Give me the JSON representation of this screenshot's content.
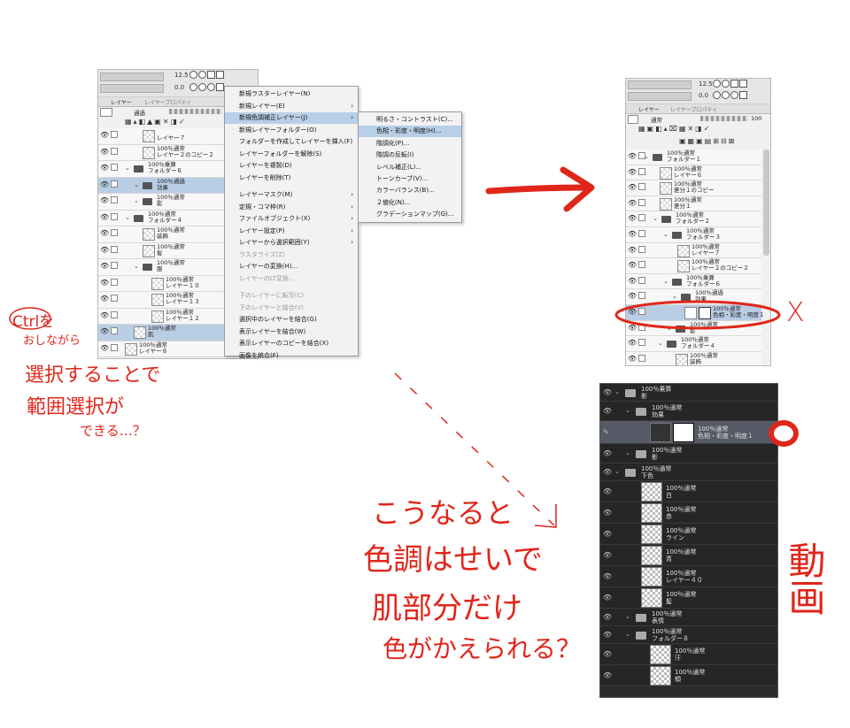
{
  "left_panel": {
    "zoom_value": "12.5",
    "rotate_value": "0.0",
    "tab_layer": "レイヤー",
    "tab_property": "レイヤープロパティ",
    "blend_mode": "通過",
    "layers": [
      {
        "title": "",
        "name": "レイヤー７",
        "kind": "layer"
      },
      {
        "title": "100％通常",
        "name": "レイヤー２のコピー２",
        "kind": "layer"
      },
      {
        "title": "100％乗算",
        "name": "フォルダー６",
        "kind": "folder"
      },
      {
        "title": "100％通過",
        "name": "効果",
        "kind": "folder",
        "selected": true
      },
      {
        "title": "100％通常",
        "name": "影",
        "kind": "folder"
      },
      {
        "title": "100％通常",
        "name": "フォルダー４",
        "kind": "folder"
      },
      {
        "title": "100％通常",
        "name": "装飾",
        "kind": "layer"
      },
      {
        "title": "100％通常",
        "name": "髪",
        "kind": "layer"
      },
      {
        "title": "100％通常",
        "name": "服",
        "kind": "folder"
      },
      {
        "title": "100％通常",
        "name": "レイヤー１０",
        "kind": "layer"
      },
      {
        "title": "100％通常",
        "name": "レイヤー１３",
        "kind": "layer"
      },
      {
        "title": "100％通常",
        "name": "レイヤー１２",
        "kind": "layer"
      },
      {
        "title": "100％通常",
        "name": "肌",
        "kind": "layer",
        "selected": true
      },
      {
        "title": "100％通常",
        "name": "レイヤー８",
        "kind": "layer"
      }
    ]
  },
  "context_menu": {
    "items": [
      {
        "label": "新規ラスターレイヤー(N)"
      },
      {
        "label": "新規レイヤー(E)",
        "submenu": true
      },
      {
        "label": "新規色調補正レイヤー(J)",
        "submenu": true,
        "highlight": true
      },
      {
        "label": "新規レイヤーフォルダー(O)"
      },
      {
        "label": "フォルダーを作成してレイヤーを挿入(F)"
      },
      {
        "label": "レイヤーフォルダーを解除(S)"
      },
      {
        "label": "レイヤーを複製(D)"
      },
      {
        "label": "レイヤーを削除(T)"
      },
      {
        "label": "レイヤーマスク(M)",
        "submenu": true
      },
      {
        "label": "定規・コマ枠(R)",
        "submenu": true
      },
      {
        "label": "ファイルオブジェクト(X)",
        "submenu": true
      },
      {
        "label": "レイヤー設定(P)",
        "submenu": true
      },
      {
        "label": "レイヤーから選択範囲(Y)",
        "submenu": true
      },
      {
        "label": "ラスタライズ(Z)",
        "disabled": true
      },
      {
        "label": "レイヤーの変換(H)..."
      },
      {
        "label": "レイヤーのLT変換...",
        "disabled": true
      },
      {
        "label": "下のレイヤーに転写(C)",
        "disabled": true
      },
      {
        "label": "下のレイヤーと結合(V)",
        "disabled": true
      },
      {
        "label": "選択中のレイヤーを結合(G)"
      },
      {
        "label": "表示レイヤーを結合(W)"
      },
      {
        "label": "表示レイヤーのコピーを結合(X)"
      },
      {
        "label": "画像を統合(F)"
      }
    ]
  },
  "submenu": {
    "items": [
      {
        "label": "明るさ・コントラスト(C)..."
      },
      {
        "label": "色相・彩度・明度(H)...",
        "highlight": true
      },
      {
        "label": "階調化(P)..."
      },
      {
        "label": "階調の反転(I)"
      },
      {
        "label": "レベル補正(L)..."
      },
      {
        "label": "トーンカーブ(V)..."
      },
      {
        "label": "カラーバランス(B)..."
      },
      {
        "label": "２値化(N)..."
      },
      {
        "label": "グラデーションマップ(G)..."
      }
    ]
  },
  "right_panel": {
    "zoom_value": "12.5",
    "rotate_value": "0.0",
    "tab_layer": "レイヤー",
    "tab_property": "レイヤープロパティ",
    "blend_mode": "通常",
    "opacity": "100",
    "layers": [
      {
        "title": "100％通常",
        "name": "フォルダー１",
        "kind": "folder"
      },
      {
        "title": "100％通常",
        "name": "レイヤー６",
        "kind": "layer"
      },
      {
        "title": "100％通常",
        "name": "差分１のコピー",
        "kind": "layer"
      },
      {
        "title": "100％通常",
        "name": "差分１",
        "kind": "layer"
      },
      {
        "title": "100％通常",
        "name": "フォルダー２",
        "kind": "folder"
      },
      {
        "title": "100％通常",
        "name": "フォルダー３",
        "kind": "folder"
      },
      {
        "title": "100％通常",
        "name": "レイヤー７",
        "kind": "layer"
      },
      {
        "title": "100％通常",
        "name": "レイヤー２のコピー２",
        "kind": "layer"
      },
      {
        "title": "100％乗算",
        "name": "フォルダー６",
        "kind": "folder"
      },
      {
        "title": "100％通過",
        "name": "効果",
        "kind": "folder"
      },
      {
        "title": "100％通常",
        "name": "色相・彩度・明度１",
        "kind": "adjust",
        "selected": true
      },
      {
        "title": "100％通常",
        "name": "影",
        "kind": "folder"
      },
      {
        "title": "100％通常",
        "name": "フォルダー４",
        "kind": "folder"
      },
      {
        "title": "100％通常",
        "name": "装飾",
        "kind": "layer"
      }
    ]
  },
  "dark_panel": {
    "layers": [
      {
        "title": "100％乗算",
        "name": "影",
        "kind": "folder"
      },
      {
        "title": "100％通常",
        "name": "効果",
        "kind": "folder"
      },
      {
        "title": "100％通常",
        "name": "色相・彩度・明度１",
        "kind": "adjust",
        "selected": true
      },
      {
        "title": "100％通常",
        "name": "影",
        "kind": "folder"
      },
      {
        "title": "100％通常",
        "name": "下色",
        "kind": "folder"
      },
      {
        "title": "100％通常",
        "name": "白",
        "kind": "layer"
      },
      {
        "title": "100％通常",
        "name": "赤",
        "kind": "layer"
      },
      {
        "title": "100％通常",
        "name": "ライン",
        "kind": "layer"
      },
      {
        "title": "100％通常",
        "name": "青",
        "kind": "layer"
      },
      {
        "title": "100％通常",
        "name": "レイヤー４０",
        "kind": "layer"
      },
      {
        "title": "100％通常",
        "name": "髪",
        "kind": "layer"
      },
      {
        "title": "100％通常",
        "name": "表情",
        "kind": "folder"
      },
      {
        "title": "100％通常",
        "name": "フォルダー８",
        "kind": "folder"
      },
      {
        "title": "100％通常",
        "name": "汗",
        "kind": "layer"
      },
      {
        "title": "100％通常",
        "name": "頬",
        "kind": "layer"
      }
    ]
  },
  "annotations": {
    "note_left_1": "Ctrlを",
    "note_left_2": "おしながら",
    "note_left_3": "選択することで",
    "note_left_4": "範囲選択が",
    "note_left_5": "できる…？",
    "mark_x": "X",
    "note_center_1": "こうなると",
    "note_center_2": "色調はせいで",
    "note_center_3": "肌部分だけ",
    "note_center_4": "色がかえられる？",
    "note_right": "動画",
    "accent_color": "#e0261b"
  }
}
